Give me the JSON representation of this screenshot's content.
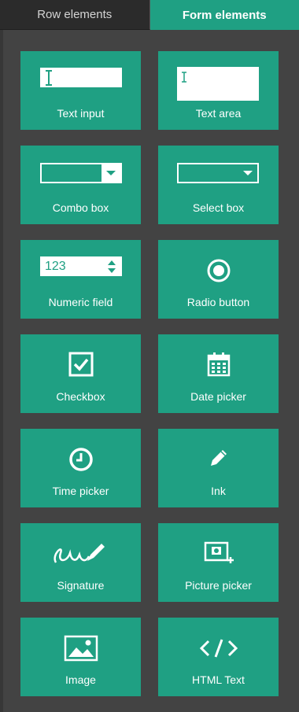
{
  "tabs": [
    {
      "label": "Row elements",
      "active": false
    },
    {
      "label": "Form elements",
      "active": true
    }
  ],
  "tiles": [
    {
      "label": "Text input",
      "icon": "text-input-icon"
    },
    {
      "label": "Text area",
      "icon": "text-area-icon"
    },
    {
      "label": "Combo box",
      "icon": "combo-box-icon"
    },
    {
      "label": "Select box",
      "icon": "select-box-icon"
    },
    {
      "label": "Numeric field",
      "icon": "numeric-field-icon",
      "sample": "123"
    },
    {
      "label": "Radio button",
      "icon": "radio-button-icon"
    },
    {
      "label": "Checkbox",
      "icon": "checkbox-icon"
    },
    {
      "label": "Date picker",
      "icon": "calendar-icon"
    },
    {
      "label": "Time picker",
      "icon": "clock-icon"
    },
    {
      "label": "Ink",
      "icon": "pencil-icon"
    },
    {
      "label": "Signature",
      "icon": "signature-icon"
    },
    {
      "label": "Picture picker",
      "icon": "camera-add-icon"
    },
    {
      "label": "Image",
      "icon": "image-icon"
    },
    {
      "label": "HTML Text",
      "icon": "code-icon",
      "sample": "</>"
    }
  ],
  "colors": {
    "accent": "#1fa083",
    "background": "#434343",
    "tab_inactive": "#2b2b2b"
  }
}
